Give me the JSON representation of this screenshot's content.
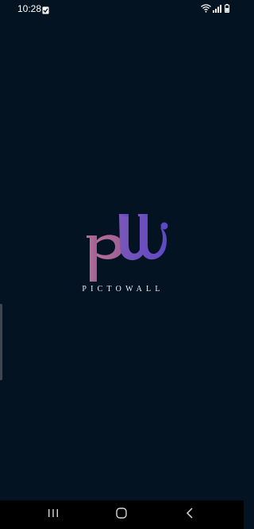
{
  "status_bar": {
    "time": "10:28",
    "icons": [
      "notification-check-icon",
      "wifi-icon",
      "signal-icon",
      "battery-icon"
    ]
  },
  "splash": {
    "logo_icon": "pictowall-logo-icon",
    "brand_name": "PICTOWALL"
  },
  "navigation_bar": {
    "buttons": [
      "recent-apps-icon",
      "home-icon",
      "back-icon"
    ]
  },
  "colors": {
    "background": "#041321",
    "logo_pink": "#b06a97",
    "logo_purple": "#6a4fbf",
    "brand_text": "#f2f2f2",
    "nav_bar": "#000000"
  }
}
